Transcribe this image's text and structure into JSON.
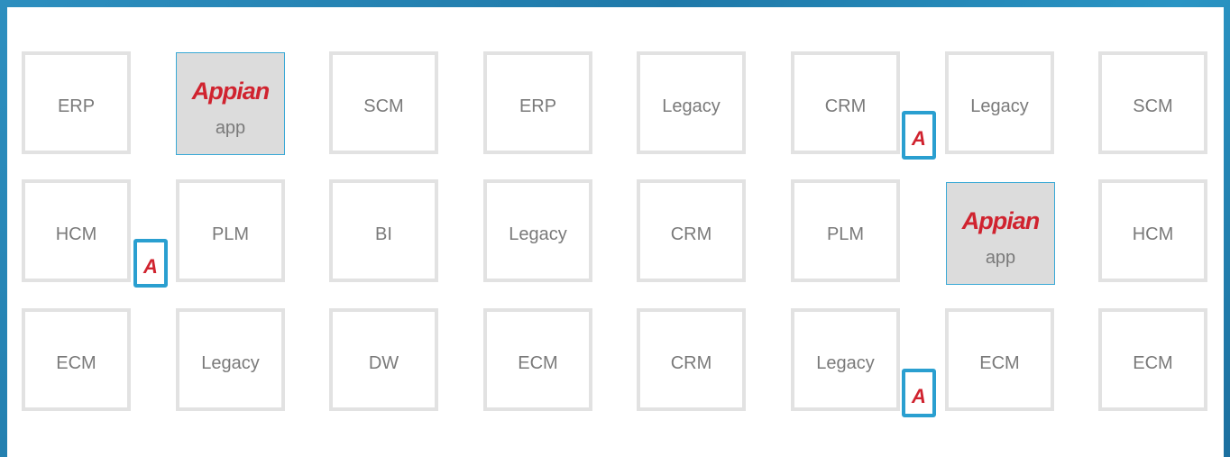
{
  "tiles": [
    [
      "ERP",
      "Appian",
      "SCM",
      "ERP",
      "Legacy",
      "CRM",
      "Legacy",
      "SCM"
    ],
    [
      "HCM",
      "PLM",
      "BI",
      "Legacy",
      "CRM",
      "PLM",
      "Appian",
      "HCM"
    ],
    [
      "ECM",
      "Legacy",
      "DW",
      "ECM",
      "CRM",
      "Legacy",
      "ECM",
      "ECM"
    ]
  ],
  "appian_tile": {
    "logo": "Appian",
    "sub": "app"
  },
  "badge_letter": "A",
  "colors": {
    "appian_red": "#d0232f",
    "badge_blue": "#2a9fd0",
    "tile_border": "#e2e2e2",
    "appian_tile_bg": "#dcdcdc",
    "frame_blue": "#2d8fbf"
  }
}
